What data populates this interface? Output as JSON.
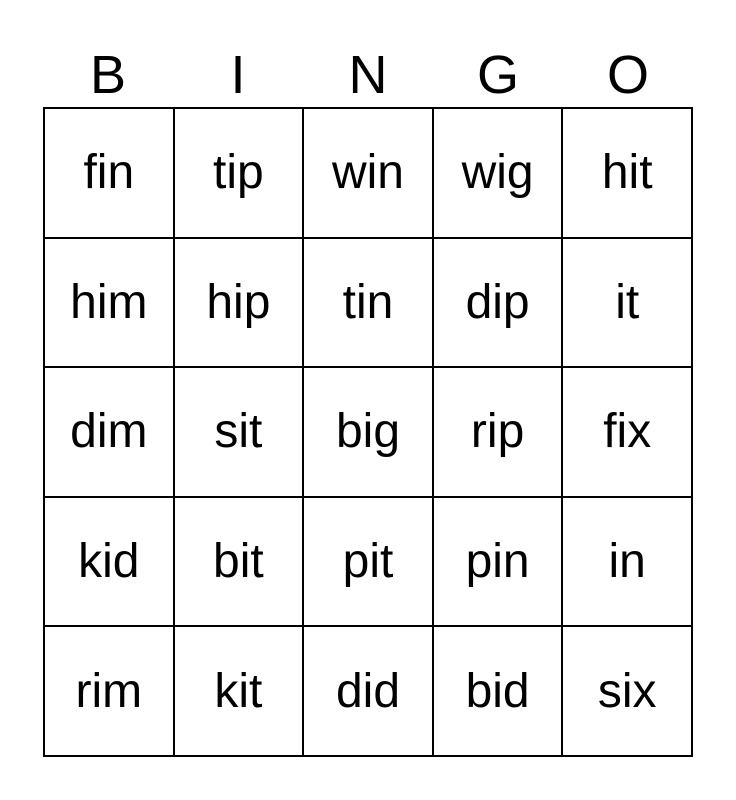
{
  "header": [
    "B",
    "I",
    "N",
    "G",
    "O"
  ],
  "cells": [
    [
      "fin",
      "tip",
      "win",
      "wig",
      "hit"
    ],
    [
      "him",
      "hip",
      "tin",
      "dip",
      "it"
    ],
    [
      "dim",
      "sit",
      "big",
      "rip",
      "fix"
    ],
    [
      "kid",
      "bit",
      "pit",
      "pin",
      "in"
    ],
    [
      "rim",
      "kit",
      "did",
      "bid",
      "six"
    ]
  ]
}
